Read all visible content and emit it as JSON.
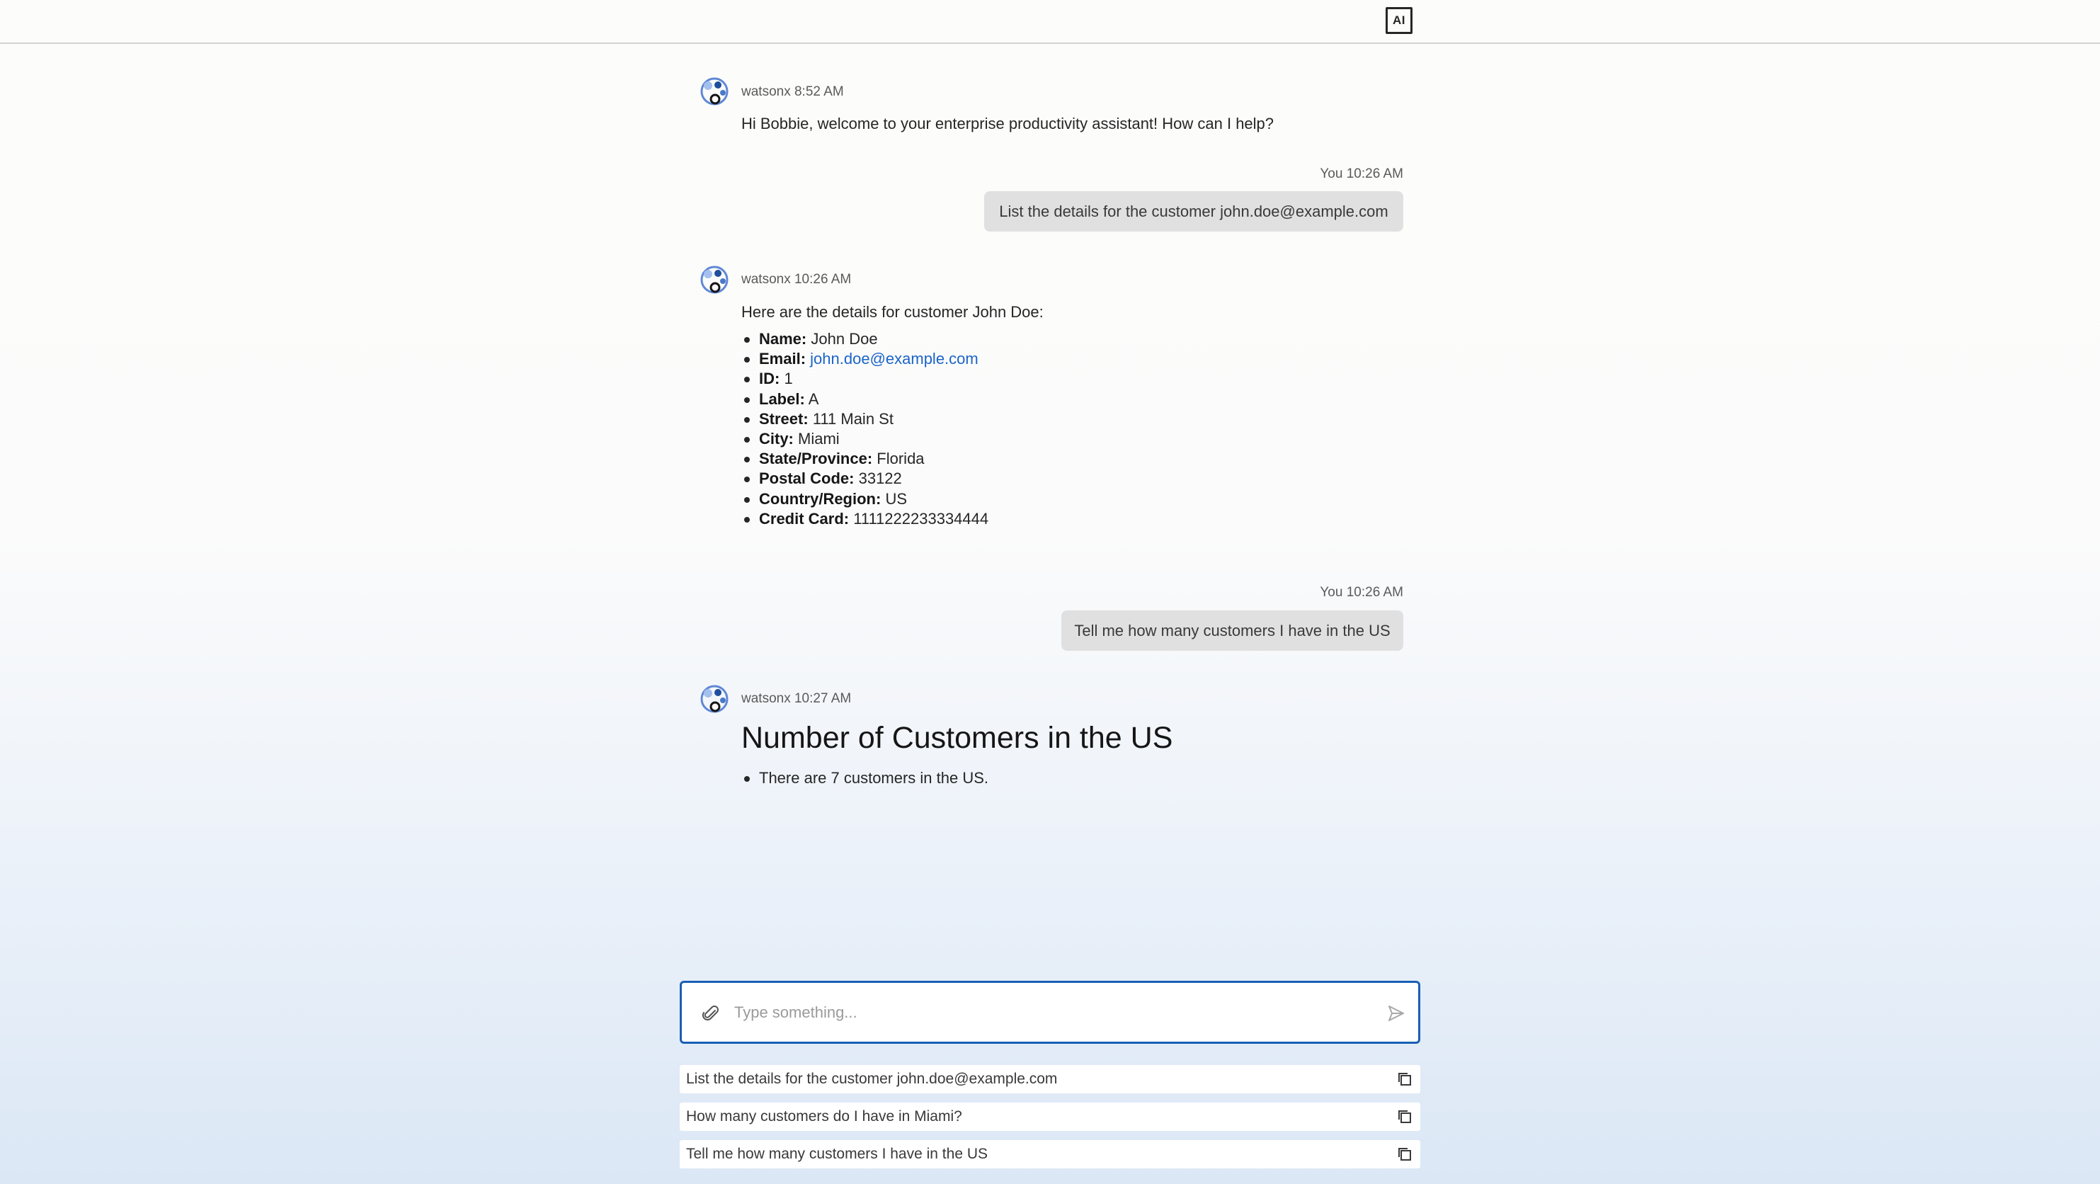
{
  "topbar": {
    "ai_badge": "AI"
  },
  "messages": {
    "m1": {
      "sender": "watsonx",
      "time": "8:52 AM",
      "text": "Hi Bobbie, welcome to your enterprise productivity assistant! How can I help?"
    },
    "m2": {
      "sender": "You",
      "time": "10:26 AM",
      "text": "List the details for the customer john.doe@example.com"
    },
    "m3": {
      "sender": "watsonx",
      "time": "10:26 AM",
      "intro": "Here are the details for customer John Doe:",
      "fields": [
        {
          "label": "Name:",
          "value": "John Doe"
        },
        {
          "label": "Email:",
          "value": "john.doe@example.com"
        },
        {
          "label": "ID:",
          "value": "1"
        },
        {
          "label": "Label:",
          "value": "A"
        },
        {
          "label": "Street:",
          "value": "111 Main St"
        },
        {
          "label": "City:",
          "value": "Miami"
        },
        {
          "label": "State/Province:",
          "value": "Florida"
        },
        {
          "label": "Postal Code:",
          "value": "33122"
        },
        {
          "label": "Country/Region:",
          "value": "US"
        },
        {
          "label": "Credit Card:",
          "value": "1111222233334444"
        }
      ]
    },
    "m4": {
      "sender": "You",
      "time": "10:26 AM",
      "text": "Tell me how many customers I have in the US"
    },
    "m5": {
      "sender": "watsonx",
      "time": "10:27 AM",
      "title": "Number of Customers in the US",
      "bullet": "There are 7 customers in the US."
    }
  },
  "composer": {
    "placeholder": "Type something...",
    "value": ""
  },
  "suggestions": [
    "List the details for the customer john.doe@example.com",
    "How many customers do I have in Miami?",
    "Tell me how many customers I have in the US"
  ],
  "colors": {
    "accent": "#1a5fb4",
    "link": "#1b64c8",
    "bubble": "#e0e0e0"
  },
  "icons": {
    "avatar": "watsonx-avatar-icon",
    "attach": "paperclip-icon",
    "send": "send-icon",
    "copy": "copy-icon"
  }
}
